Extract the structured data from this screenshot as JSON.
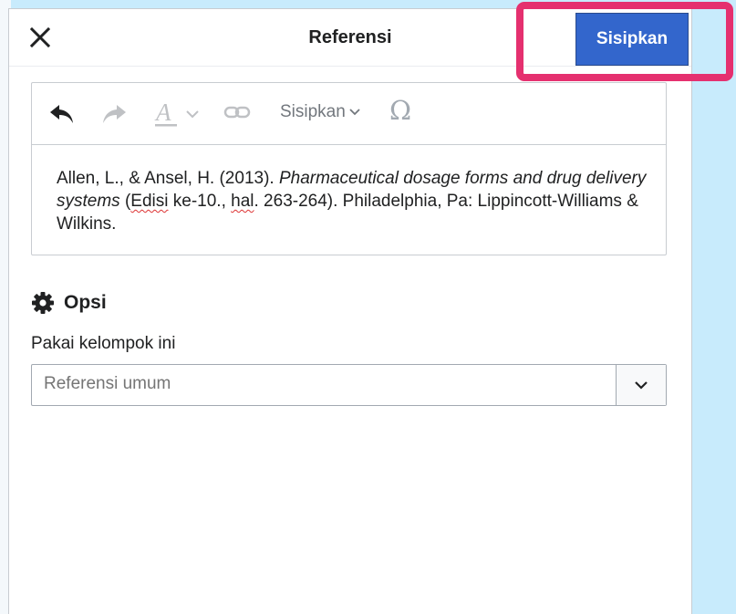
{
  "dialog": {
    "title": "Referensi",
    "close_icon": "close-icon",
    "primary_action_label": "Sisipkan",
    "highlight_color": "#e5306f",
    "accent_color": "#3366cc"
  },
  "toolbar": {
    "undo_icon": "undo-icon",
    "redo_icon": "redo-icon",
    "text_style_icon": "text-style-icon",
    "link_icon": "link-icon",
    "insert_menu_label": "Sisipkan",
    "special_char_symbol": "Ω"
  },
  "citation": {
    "part1": "Allen, L., & Ansel, H. (2013). ",
    "title_italic": "Pharmaceutical dosage forms and drug delivery systems",
    "part2": " (",
    "edition_word": "Edisi",
    "part3": " ke-10., ",
    "page_word": "hal",
    "part4": ". 263-264). Philadelphia, Pa: Lippincott-Williams & Wilkins."
  },
  "options": {
    "heading": "Opsi",
    "heading_icon": "gear-icon",
    "group_label": "Pakai kelompok ini",
    "group_placeholder": "Referensi umum"
  }
}
